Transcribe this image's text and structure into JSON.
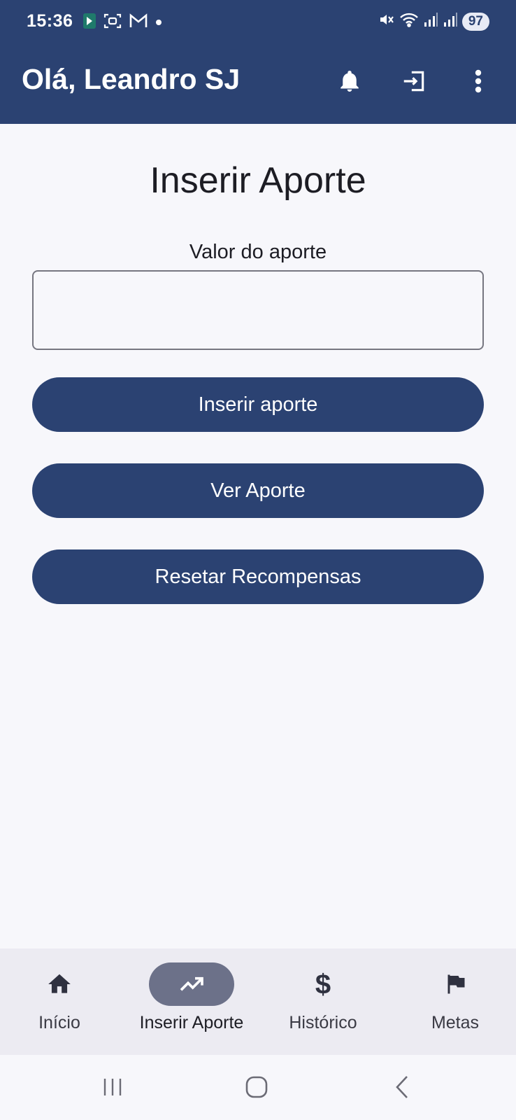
{
  "status_bar": {
    "time": "15:36",
    "battery": "97"
  },
  "app_bar": {
    "title": "Olá, Leandro SJ",
    "actions": [
      "bell-icon",
      "logout-icon",
      "more-vert-icon"
    ]
  },
  "main": {
    "page_title": "Inserir Aporte",
    "field_label": "Valor do aporte",
    "input_value": "",
    "input_placeholder": "",
    "buttons": {
      "insert": "Inserir aporte",
      "view": "Ver Aporte",
      "reset": "Resetar Recompensas"
    }
  },
  "bottom_nav": {
    "items": [
      {
        "label": "Início",
        "icon": "home-icon",
        "active": false
      },
      {
        "label": "Inserir Aporte",
        "icon": "trending-up-icon",
        "active": true
      },
      {
        "label": "Histórico",
        "icon": "dollar-icon",
        "active": false
      },
      {
        "label": "Metas",
        "icon": "flag-icon",
        "active": false
      }
    ]
  },
  "colors": {
    "primary": "#2b4272",
    "background": "#f7f7fb",
    "nav_background": "#ecebf2",
    "active_indicator": "#6c7189"
  }
}
